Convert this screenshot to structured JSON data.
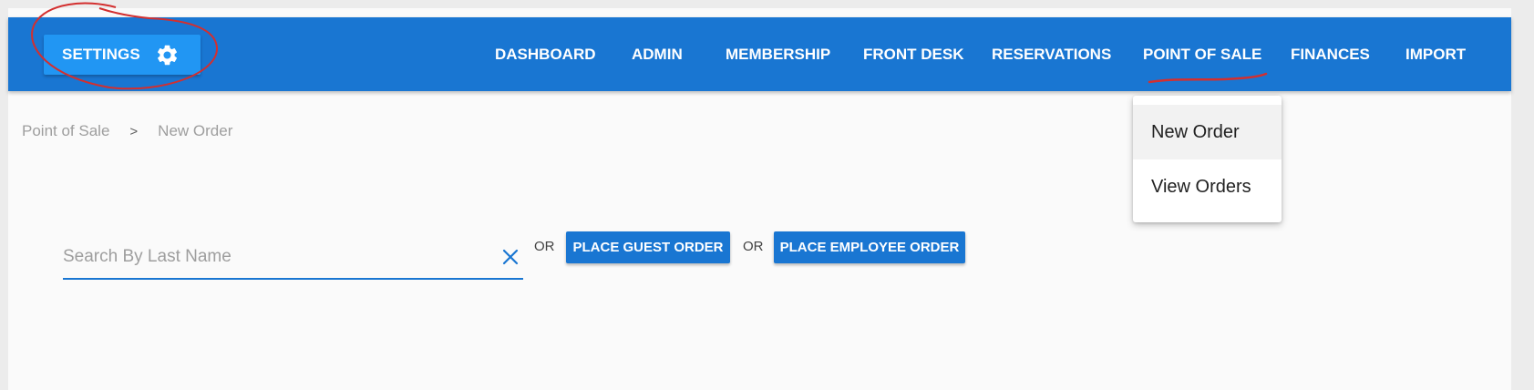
{
  "navbar": {
    "settings_label": "SETTINGS",
    "settings_icon": "gear-icon",
    "items": [
      {
        "label": "DASHBOARD"
      },
      {
        "label": "ADMIN"
      },
      {
        "label": "MEMBERSHIP"
      },
      {
        "label": "FRONT DESK"
      },
      {
        "label": "RESERVATIONS"
      },
      {
        "label": "POINT OF SALE"
      },
      {
        "label": "FINANCES"
      },
      {
        "label": "IMPORT"
      }
    ],
    "active_item": "POINT OF SALE"
  },
  "breadcrumb": {
    "items": [
      "Point of Sale",
      "New Order"
    ],
    "separator": ">"
  },
  "search": {
    "placeholder": "Search By Last Name",
    "value": "",
    "clear_icon": "close-icon"
  },
  "actions": {
    "or_1": "OR",
    "guest_order_label": "PLACE GUEST ORDER",
    "or_2": "OR",
    "employee_order_label": "PLACE EMPLOYEE ORDER"
  },
  "dropdown": {
    "items": [
      {
        "label": "New Order",
        "active": true
      },
      {
        "label": "View Orders",
        "active": false
      }
    ]
  },
  "colors": {
    "primary": "#1976d2",
    "settings_button": "#2196f3",
    "annotation": "#d32f2f"
  }
}
